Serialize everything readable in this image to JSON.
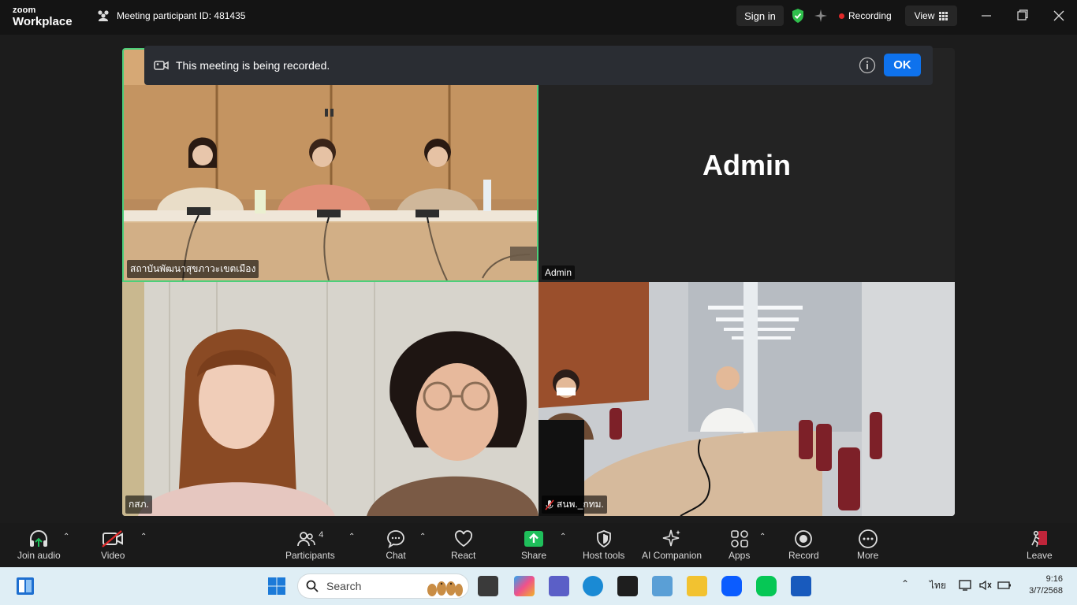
{
  "titlebar": {
    "logo_line1": "zoom",
    "logo_line2": "Workplace",
    "meeting_id": "Meeting participant ID: 481435",
    "sign_in": "Sign in",
    "recording": "Recording",
    "view": "View"
  },
  "banner": {
    "text": "This meeting is being recorded.",
    "ok": "OK"
  },
  "tiles": {
    "t1_label": "สถาบันพัฒนาสุขภาวะเขตเมือง",
    "t2_name": "Admin",
    "t2_label": "Admin",
    "t3_label": "กสภ.",
    "t4_label": "สนพ._กทม."
  },
  "toolbar": {
    "join_audio": "Join audio",
    "video": "Video",
    "participants": "Participants",
    "participants_count": "4",
    "chat": "Chat",
    "react": "React",
    "share": "Share",
    "host_tools": "Host tools",
    "ai_companion": "AI Companion",
    "apps": "Apps",
    "record": "Record",
    "more": "More",
    "leave": "Leave"
  },
  "taskbar": {
    "search_placeholder": "Search",
    "language": "ไทย",
    "time": "9:16",
    "date": "3/7/2568"
  },
  "colors": {
    "accent_blue": "#0e72ed",
    "active_speaker_border": "#4ccf7a",
    "recording_red": "#e02828",
    "share_green": "#1fbf5b"
  }
}
